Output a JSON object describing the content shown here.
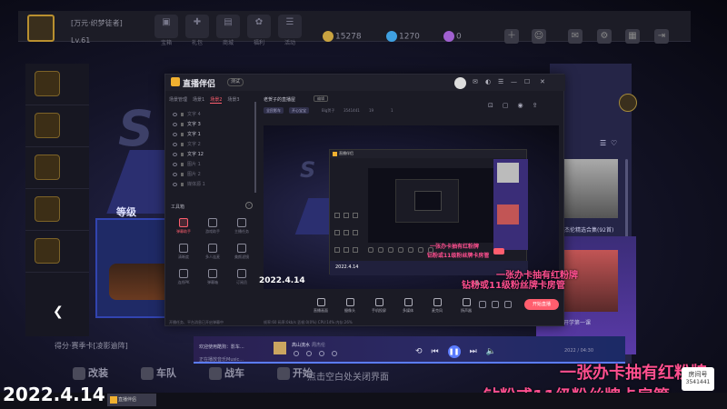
{
  "game": {
    "player_name": "[万元·织梦徒者]",
    "level": "Lv.61",
    "nav": [
      {
        "icon": "box-icon",
        "label": "宝箱"
      },
      {
        "icon": "gift-icon",
        "label": "礼包"
      },
      {
        "icon": "shop-icon",
        "label": "商城"
      },
      {
        "icon": "gift2-icon",
        "label": "福利"
      },
      {
        "icon": "event-icon",
        "label": "活动"
      }
    ],
    "gold": "15278",
    "diamond": "1270",
    "other_currency": "0",
    "bottom_nav": [
      "改装",
      "车队",
      "战车",
      "开始"
    ],
    "tip": "点击空白处关闭界面",
    "score_text": "得分·赛季卡[凌影逾阵]",
    "level_label": "等级"
  },
  "obs": {
    "app_name": "直播伴侣",
    "version_badge": "测试",
    "scene_tabs": [
      "场景管理",
      "场景1",
      "场景2",
      "场景3"
    ],
    "active_scene_tab": 2,
    "scenes": [
      "文字 4",
      "文字 3",
      "文字 1",
      "文字 2",
      "文字 12",
      "图片 1",
      "图片 2",
      "媒体源 1"
    ],
    "tools_title": "工具箱",
    "tools": [
      {
        "label": "弹幕助手",
        "active": true
      },
      {
        "label": "游戏助手",
        "active": false
      },
      {
        "label": "主播任务",
        "active": false
      },
      {
        "label": "清晰度",
        "active": false
      },
      {
        "label": "多人连麦",
        "active": false
      },
      {
        "label": "美颜滤镜",
        "active": false
      },
      {
        "label": "连线PK",
        "active": false
      },
      {
        "label": "弹幕箱",
        "active": false
      },
      {
        "label": "订阅员",
        "active": false
      }
    ],
    "left_status": "开播任务、平台消息已开启弹幕中",
    "room_title": "老贺子的直播屋",
    "edit_label": "编辑",
    "tag1": "全民影车",
    "tag2": "开心宝宝",
    "info_user": "Big贺子",
    "info_id": "3541441",
    "info_viewers": "19",
    "info_fans": "1",
    "preview_date": "2022.4.14",
    "controls": [
      "直播画面",
      "摄像头",
      "手机投屏",
      "多媒体",
      "麦克风",
      "扬声器"
    ],
    "start_label": "开始直播",
    "status_bar": "帧率:60  码率:0kb/s  丢帧:0(0%)  CPU:14%  内存:26%"
  },
  "music": {
    "text1": "欢迎使用酷狗：影车...",
    "text2": "正在播放音乐Music...",
    "song": "高山流水",
    "artist": "周杰伦",
    "time": "2022 / 04:30"
  },
  "overlay": {
    "date": "2022.4.14",
    "pink_line1": "一张办卡抽有红粉牌",
    "pink_line2": "钻粉或11级粉丝牌卡房管",
    "room_label": "房间号",
    "room_id": "3541441"
  },
  "right_panel": {
    "song_text": "周杰伦精选合集(92首)",
    "album_text": "开学第一课"
  },
  "taskbar": {
    "app_label": "直播伴侣"
  }
}
